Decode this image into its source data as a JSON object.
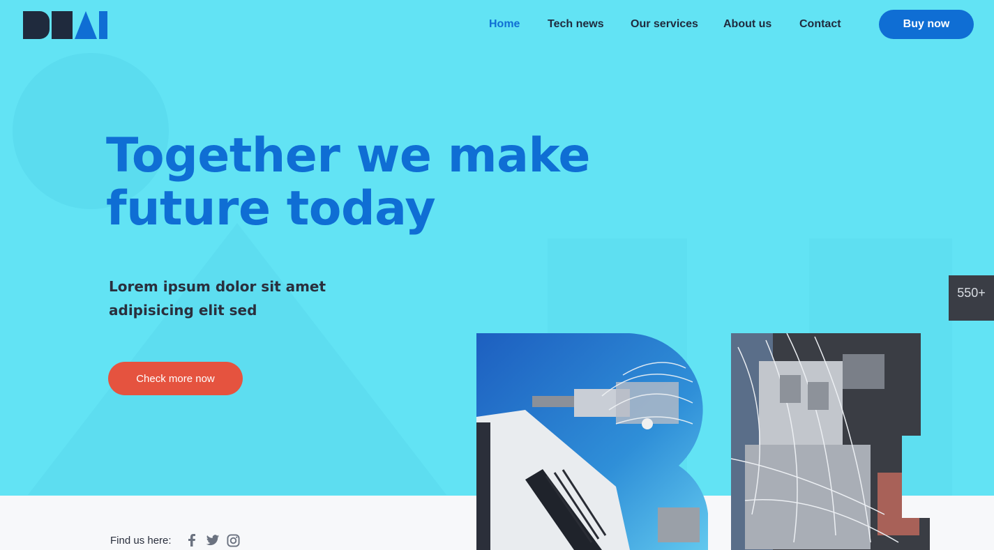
{
  "brand": {
    "logo_text": "BEAI"
  },
  "nav": {
    "items": [
      {
        "label": "Home",
        "active": true
      },
      {
        "label": "Tech news",
        "active": false
      },
      {
        "label": "Our services",
        "active": false
      },
      {
        "label": "About us",
        "active": false
      },
      {
        "label": "Contact",
        "active": false
      }
    ],
    "buy_label": "Buy now"
  },
  "hero": {
    "headline_line1": "Together we make",
    "headline_line2": "future today",
    "subtitle_line1": "Lorem ipsum dolor sit amet",
    "subtitle_line2": "adipisicing elit sed",
    "cta_label": "Check more now"
  },
  "stat_badge": {
    "value": "550+"
  },
  "footer": {
    "find_label": "Find us here:",
    "social_icons": [
      "facebook-icon",
      "twitter-icon",
      "instagram-icon"
    ]
  },
  "colors": {
    "hero_bg": "#62e3f4",
    "accent_blue": "#0f6ed4",
    "cta_orange": "#e5533f",
    "dark_text": "#1f2a3d"
  }
}
